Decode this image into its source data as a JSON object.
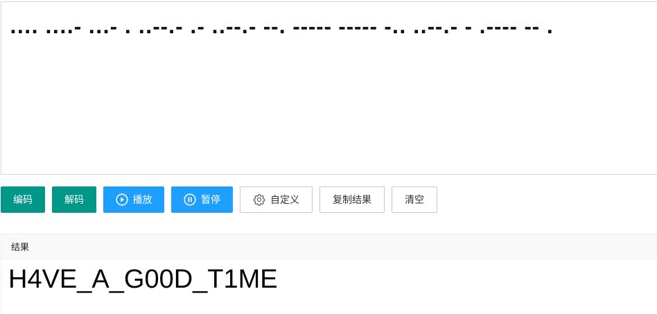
{
  "input": {
    "morse_text": ".... ....- ...- . ..--.- .- ..--.- --. ----- ----- -.. ..--.- - .---- -- ."
  },
  "toolbar": {
    "encode_label": "编码",
    "decode_label": "解码",
    "play_label": "播放",
    "pause_label": "暂停",
    "custom_label": "自定义",
    "copy_label": "复制结果",
    "clear_label": "清空"
  },
  "result": {
    "header": "结果",
    "value": "H4VE_A_G00D_T1ME"
  },
  "colors": {
    "green": "#009688",
    "blue": "#1e9fff",
    "border": "#c9c9c9",
    "header_bg": "#f9f9f9"
  },
  "icons": {
    "play": "play-circle-icon",
    "pause": "pause-circle-icon",
    "custom": "gear-icon"
  }
}
